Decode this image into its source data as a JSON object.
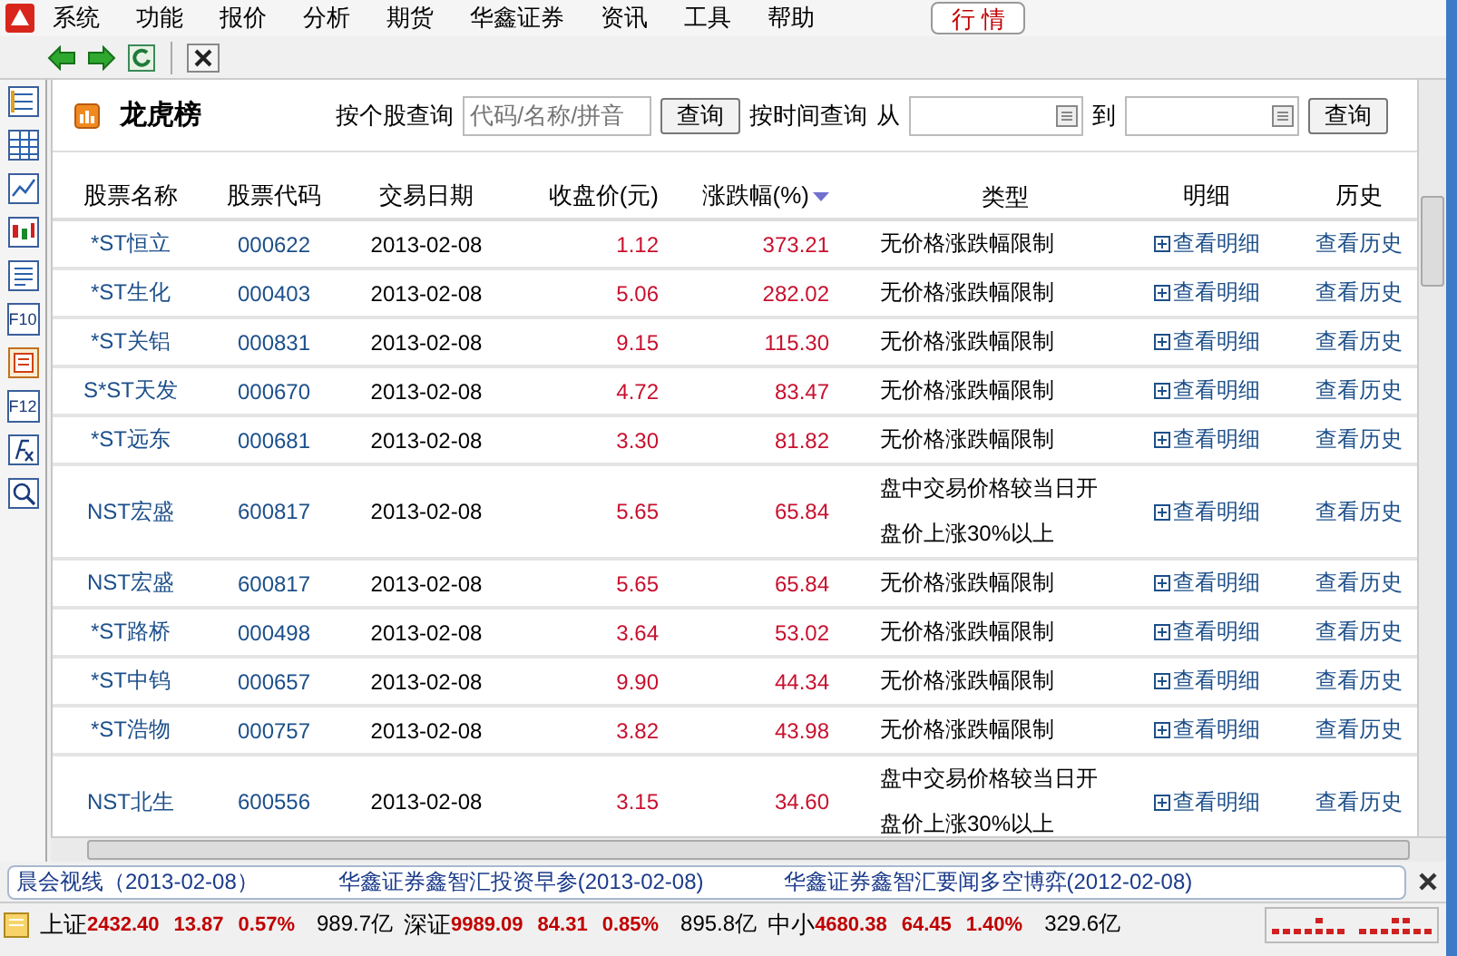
{
  "menu": {
    "items": [
      "系统",
      "功能",
      "报价",
      "分析",
      "期货",
      "华鑫证券",
      "资讯",
      "工具",
      "帮助"
    ],
    "quote_button": "行 情"
  },
  "sidebar": {
    "items": [
      {
        "kind": "list"
      },
      {
        "kind": "grid"
      },
      {
        "kind": "line"
      },
      {
        "kind": "candles"
      },
      {
        "kind": "doc"
      },
      {
        "kind": "text",
        "label": "F10"
      },
      {
        "kind": "report"
      },
      {
        "kind": "text",
        "label": "F12"
      },
      {
        "kind": "formula"
      },
      {
        "kind": "search"
      }
    ]
  },
  "panel": {
    "title": "龙虎榜",
    "stock_query_label": "按个股查询",
    "stock_query": {
      "placeholder": "代码/名称/拼音"
    },
    "query_button": "查询",
    "time_query_label": "按时间查询",
    "from_label": "从",
    "to_label": "到",
    "time_query_button": "查询"
  },
  "table": {
    "columns": [
      {
        "label": "股票名称",
        "sorted": false
      },
      {
        "label": "股票代码",
        "sorted": false
      },
      {
        "label": "交易日期",
        "sorted": false
      },
      {
        "label": "收盘价(元)",
        "sorted": false
      },
      {
        "label": "涨跌幅(%)",
        "sorted": true
      },
      {
        "label": "类型",
        "sorted": false
      },
      {
        "label": "明细",
        "sorted": false
      },
      {
        "label": "历史",
        "sorted": false
      }
    ],
    "rows": [
      {
        "name": "*ST恒立",
        "code": "000622",
        "date": "2013-02-08",
        "price": "1.12",
        "change": "373.21",
        "type": "无价格涨跌幅限制",
        "detail": "查看明细",
        "history": "查看历史"
      },
      {
        "name": "*ST生化",
        "code": "000403",
        "date": "2013-02-08",
        "price": "5.06",
        "change": "282.02",
        "type": "无价格涨跌幅限制",
        "detail": "查看明细",
        "history": "查看历史"
      },
      {
        "name": "*ST关铝",
        "code": "000831",
        "date": "2013-02-08",
        "price": "9.15",
        "change": "115.30",
        "type": "无价格涨跌幅限制",
        "detail": "查看明细",
        "history": "查看历史"
      },
      {
        "name": "S*ST天发",
        "code": "000670",
        "date": "2013-02-08",
        "price": "4.72",
        "change": "83.47",
        "type": "无价格涨跌幅限制",
        "detail": "查看明细",
        "history": "查看历史"
      },
      {
        "name": "*ST远东",
        "code": "000681",
        "date": "2013-02-08",
        "price": "3.30",
        "change": "81.82",
        "type": "无价格涨跌幅限制",
        "detail": "查看明细",
        "history": "查看历史"
      },
      {
        "name": "NST宏盛",
        "code": "600817",
        "date": "2013-02-08",
        "price": "5.65",
        "change": "65.84",
        "type": "盘中交易价格较当日开盘价上涨30%以上",
        "detail": "查看明细",
        "history": "查看历史"
      },
      {
        "name": "NST宏盛",
        "code": "600817",
        "date": "2013-02-08",
        "price": "5.65",
        "change": "65.84",
        "type": "无价格涨跌幅限制",
        "detail": "查看明细",
        "history": "查看历史"
      },
      {
        "name": "*ST路桥",
        "code": "000498",
        "date": "2013-02-08",
        "price": "3.64",
        "change": "53.02",
        "type": "无价格涨跌幅限制",
        "detail": "查看明细",
        "history": "查看历史"
      },
      {
        "name": "*ST中钨",
        "code": "000657",
        "date": "2013-02-08",
        "price": "9.90",
        "change": "44.34",
        "type": "无价格涨跌幅限制",
        "detail": "查看明细",
        "history": "查看历史"
      },
      {
        "name": "*ST浩物",
        "code": "000757",
        "date": "2013-02-08",
        "price": "3.82",
        "change": "43.98",
        "type": "无价格涨跌幅限制",
        "detail": "查看明细",
        "history": "查看历史"
      },
      {
        "name": "NST北生",
        "code": "600556",
        "date": "2013-02-08",
        "price": "3.15",
        "change": "34.60",
        "type": "盘中交易价格较当日开盘价上涨30%以上",
        "detail": "查看明细",
        "history": "查看历史"
      }
    ]
  },
  "news": [
    "晨会视线（2013-02-08）",
    "华鑫证券鑫智汇投资早参(2013-02-08)",
    "华鑫证券鑫智汇要闻多空博弈(2012-02-08)"
  ],
  "status_bar": {
    "indices": [
      {
        "name": "上证",
        "value": "2432.40",
        "change": "13.87",
        "percent": "0.57%",
        "volume": "989.7亿"
      },
      {
        "name": "深证",
        "value": "9989.09",
        "change": "84.31",
        "percent": "0.85%",
        "volume": "895.8亿"
      },
      {
        "name": "中小",
        "value": "4680.38",
        "change": "64.45",
        "percent": "1.40%",
        "volume": "329.6亿"
      }
    ]
  }
}
